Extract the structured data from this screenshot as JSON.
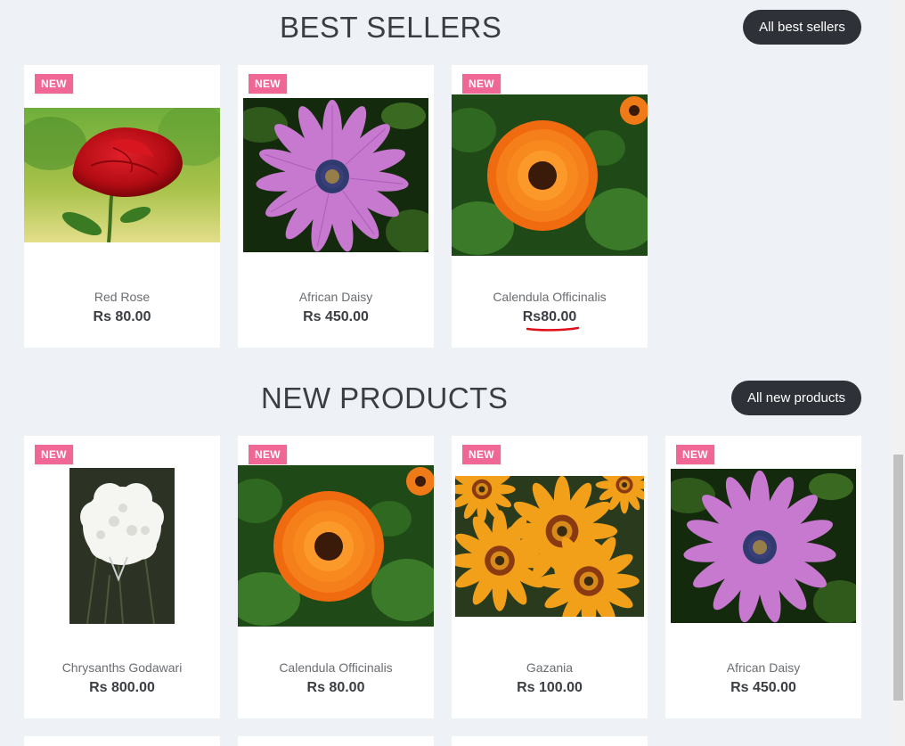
{
  "best_sellers": {
    "title": "BEST SELLERS",
    "button_label": "All best sellers",
    "products": [
      {
        "badge": "NEW",
        "name": "Red Rose",
        "price": "Rs 80.00"
      },
      {
        "badge": "NEW",
        "name": "African Daisy",
        "price": "Rs 450.00"
      },
      {
        "badge": "NEW",
        "name": "Calendula Officinalis",
        "price": "Rs80.00"
      }
    ]
  },
  "new_products": {
    "title": "NEW PRODUCTS",
    "button_label": "All new products",
    "products": [
      {
        "badge": "NEW",
        "name": "Chrysanths Godawari",
        "price": "Rs 800.00"
      },
      {
        "badge": "NEW",
        "name": "Calendula Officinalis",
        "price": "Rs 80.00"
      },
      {
        "badge": "NEW",
        "name": "Gazania",
        "price": "Rs 100.00"
      },
      {
        "badge": "NEW",
        "name": "African Daisy",
        "price": "Rs 450.00"
      }
    ]
  },
  "colors": {
    "background": "#eef2f6",
    "badge": "#f06795",
    "button": "#2e3137",
    "annotation": "#e0101a"
  }
}
